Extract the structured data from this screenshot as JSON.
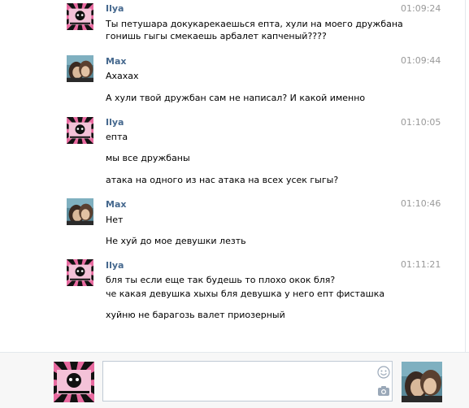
{
  "users": {
    "ilya": {
      "name": "Ilya",
      "avatar_icon": "pink-black-sunburst-avatar"
    },
    "max": {
      "name": "Max",
      "avatar_icon": "couple-photo-avatar"
    }
  },
  "messages": [
    {
      "author": "Ilya",
      "time": "01:09:24",
      "lines": [
        "Ты петушара докукарекаешься епта, хули на моего дружбана",
        "гонишь гыгы смекаешь арбалет капченый????"
      ]
    },
    {
      "author": "Max",
      "time": "01:09:44",
      "lines": [
        "Ахахах",
        "А хули твой дружбан сам не написал? И какой именно"
      ]
    },
    {
      "author": "Ilya",
      "time": "01:10:05",
      "lines": [
        "епта",
        "мы все дружбаны",
        "атака на одного из нас атака на всех усек гыгы?"
      ]
    },
    {
      "author": "Max",
      "time": "01:10:46",
      "lines": [
        "Нет",
        "Не хуй до мое девушки лезть"
      ]
    },
    {
      "author": "Ilya",
      "time": "01:11:21",
      "lines": [
        "бля ты если еще так будешь то плохо окок бля?",
        "че какая девушка хыхы бля девушка у него епт фисташка",
        "хуйню не барагозь валет приозерный"
      ]
    }
  ],
  "composer": {
    "placeholder": "",
    "value": "",
    "emoji_icon": "smiley-icon",
    "attach_icon": "camera-icon"
  },
  "colors": {
    "author": "#45688e",
    "time": "#999999",
    "footer_bg": "#f7f7f7",
    "pink": "#e86aa0"
  }
}
